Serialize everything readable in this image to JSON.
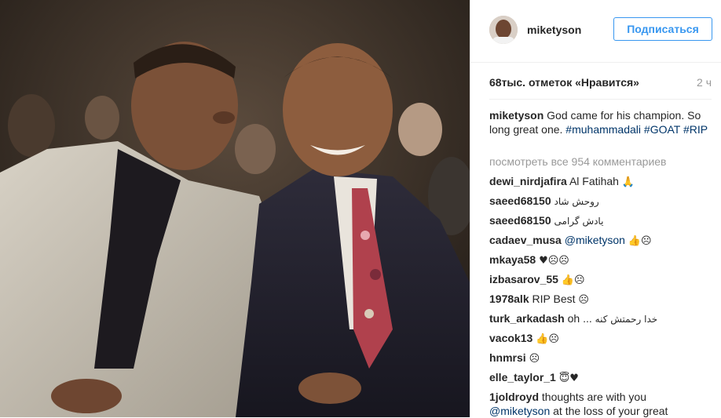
{
  "post": {
    "username": "miketyson",
    "follow_label": "Подписаться",
    "likes": "68тыс. отметок «Нравится»",
    "time": "2 ч",
    "caption": {
      "user": "miketyson",
      "text": "God came for his champion. So long great one.",
      "tags": [
        "#muhammadali",
        "#GOAT",
        "#RIP"
      ]
    },
    "view_all": "посмотреть все 954 комментариев"
  },
  "comments": [
    {
      "user": "dewi_nirdjafira",
      "text": "Al Fatihah",
      "emoji": "🙏"
    },
    {
      "user": "saeed68150",
      "text": "روحش شاد",
      "rtl": true
    },
    {
      "user": "saeed68150",
      "text": "یادش گرامی",
      "rtl": true
    },
    {
      "user": "cadaev_musa",
      "mention": "@miketyson",
      "emoji": "👍☹"
    },
    {
      "user": "mkaya58",
      "emoji": "♥☹☹"
    },
    {
      "user": "izbasarov_55",
      "emoji": "👍☹"
    },
    {
      "user": "1978alk",
      "text": "RIP Best",
      "emoji": "☹"
    },
    {
      "user": "turk_arkadash",
      "text": "oh ...",
      "rtl_text": "خدا رحمتش کنه"
    },
    {
      "user": "vacok13",
      "emoji": "👍☹"
    },
    {
      "user": "hnmrsi",
      "emoji": "☹"
    },
    {
      "user": "elle_taylor_1",
      "emoji": "😇♥"
    },
    {
      "user": "1joldroyd",
      "text": "thoughts are with you",
      "mention": "@miketyson",
      "text2": "at the loss of your great"
    }
  ]
}
